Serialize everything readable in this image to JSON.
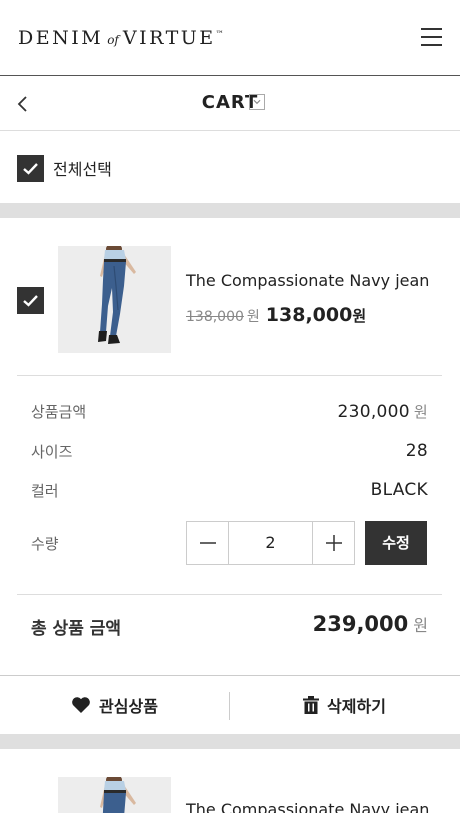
{
  "header": {
    "logo_left": "DENIM",
    "logo_of": "of",
    "logo_right": "VIRTUE",
    "logo_tm": "™",
    "menu_icon": "hamburger-menu-icon"
  },
  "subheader": {
    "title": "CART",
    "back_icon": "chevron-left-icon",
    "dropdown_icon": "chevron-down-icon"
  },
  "select_all": {
    "label": "전체선택",
    "checked": true
  },
  "items": [
    {
      "checked": true,
      "name": "The Compassionate Navy jean",
      "original_price": "138,000",
      "original_currency": "원",
      "sale_price": "138,000",
      "sale_currency": "원",
      "details": {
        "price_label": "상품금액",
        "price_value": "230,000",
        "price_unit": "원",
        "size_label": "사이즈",
        "size_value": "28",
        "color_label": "컬러",
        "color_value": "BLACK",
        "qty_label": "수량",
        "qty_value": "2",
        "update_label": "수정"
      },
      "total_label": "총 상품 금액",
      "total_value": "239,000",
      "total_unit": "원",
      "wishlist_label": "관심상품",
      "delete_label": "삭제하기"
    },
    {
      "name": "The Compassionate Navy jean"
    }
  ],
  "colors": {
    "dark": "#333333",
    "divider": "#dddddd",
    "section_gap": "#dfdfdf",
    "muted": "#888888"
  }
}
